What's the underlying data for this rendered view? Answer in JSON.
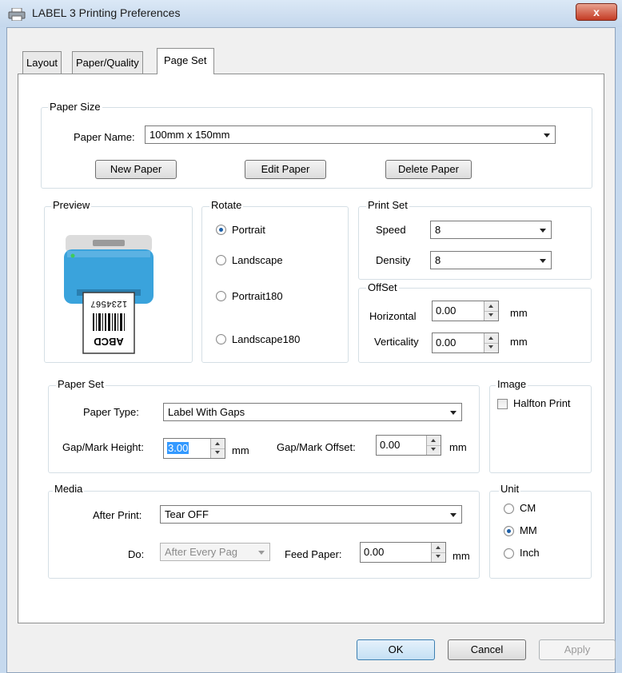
{
  "window": {
    "title": "LABEL 3 Printing Preferences",
    "close_glyph": "x"
  },
  "tabs": [
    "Layout",
    "Paper/Quality",
    "Page Set"
  ],
  "paper_size": {
    "legend": "Paper Size",
    "paper_name_label": "Paper Name:",
    "paper_name_value": "100mm x 150mm",
    "new_paper": "New Paper",
    "edit_paper": "Edit Paper",
    "delete_paper": "Delete Paper"
  },
  "preview": {
    "legend": "Preview",
    "label_digits": "1234567",
    "label_letters": "ABCD"
  },
  "rotate": {
    "legend": "Rotate",
    "options": [
      "Portrait",
      "Landscape",
      "Portrait180",
      "Landscape180"
    ],
    "selected": "Portrait"
  },
  "print_set": {
    "legend": "Print Set",
    "speed_label": "Speed",
    "speed_value": "8",
    "density_label": "Density",
    "density_value": "8"
  },
  "offset": {
    "legend": "OffSet",
    "horizontal_label": "Horizontal",
    "horizontal_value": "0.00",
    "verticality_label": "Verticality",
    "verticality_value": "0.00",
    "unit": "mm"
  },
  "paper_set": {
    "legend": "Paper Set",
    "paper_type_label": "Paper Type:",
    "paper_type_value": "Label With Gaps",
    "gap_height_label": "Gap/Mark Height:",
    "gap_height_value": "3.00",
    "gap_offset_label": "Gap/Mark Offset:",
    "gap_offset_value": "0.00",
    "unit": "mm"
  },
  "image": {
    "legend": "Image",
    "halfton_label": "Halfton Print",
    "halfton_checked": false
  },
  "media": {
    "legend": "Media",
    "after_print_label": "After Print:",
    "after_print_value": "Tear OFF",
    "do_label": "Do:",
    "do_value": "After Every Pag",
    "feed_paper_label": "Feed Paper:",
    "feed_paper_value": "0.00",
    "unit": "mm"
  },
  "unit": {
    "legend": "Unit",
    "options": [
      "CM",
      "MM",
      "Inch"
    ],
    "selected": "MM"
  },
  "buttons": {
    "ok": "OK",
    "cancel": "Cancel",
    "apply": "Apply"
  },
  "colors": {
    "printer_body": "#3aa3dc",
    "printer_top": "#d6d6d6",
    "indicator": "#3ecb5a"
  }
}
